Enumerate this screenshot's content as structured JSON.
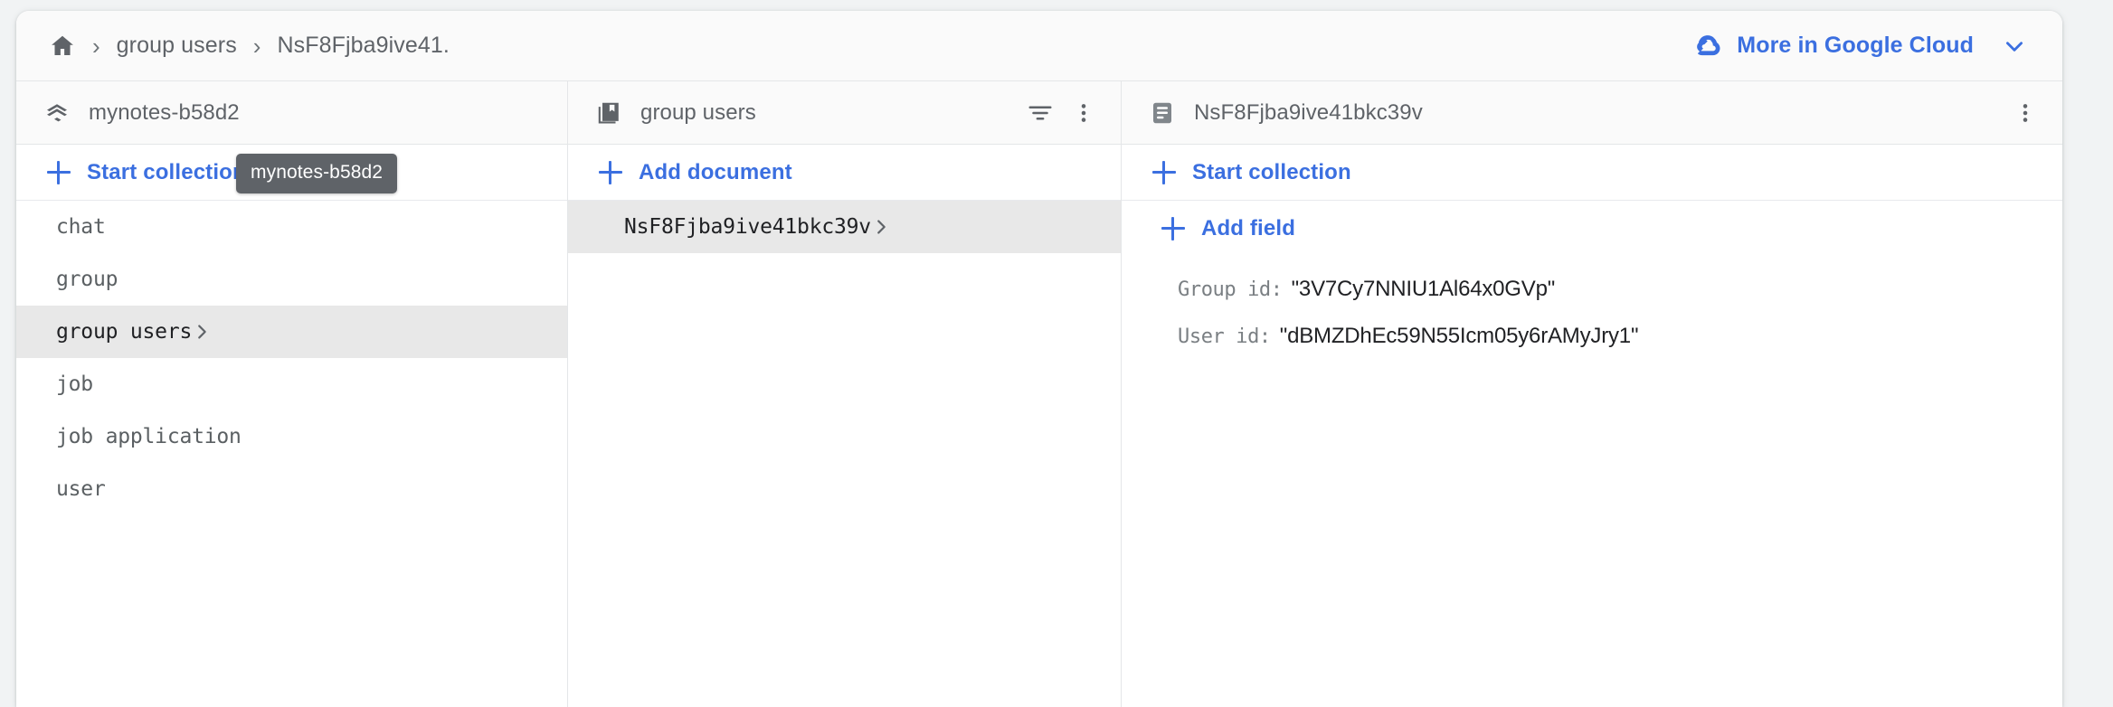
{
  "colors": {
    "accent": "#3b6fe0",
    "page_bg": "#f1f3f4",
    "panel_bg": "#ffffff",
    "header_bg": "#fafafa",
    "selected_row_bg": "#e8e8e8",
    "tooltip_bg": "#5f6368",
    "muted_text": "#5f6368"
  },
  "breadcrumb": {
    "home_icon": "home-icon",
    "separator": "chevron-right-icon",
    "items": [
      {
        "label": "group users"
      },
      {
        "label": "NsF8Fjba9ive41."
      }
    ]
  },
  "topbar": {
    "cloud_icon": "google-cloud-icon",
    "more_label": "More in Google Cloud",
    "chevron_icon": "chevron-down-icon"
  },
  "tooltip": {
    "text": "mynotes-b58d2"
  },
  "panel_database": {
    "icon": "firestore-database-icon",
    "title": "mynotes-b58d2",
    "start_collection_label": "Start collection",
    "start_collection_icon": "plus-icon",
    "collections": [
      {
        "name": "chat",
        "selected": false
      },
      {
        "name": "group",
        "selected": false
      },
      {
        "name": "group users",
        "selected": true
      },
      {
        "name": "job",
        "selected": false
      },
      {
        "name": "job application",
        "selected": false
      },
      {
        "name": "user",
        "selected": false
      }
    ]
  },
  "panel_collection": {
    "icon": "collection-icon",
    "title": "group users",
    "filter_icon": "filter-icon",
    "menu_icon": "more-vert-icon",
    "add_document_label": "Add document",
    "add_document_icon": "plus-icon",
    "documents": [
      {
        "id": "NsF8Fjba9ive41bkc39v",
        "selected": true
      }
    ]
  },
  "panel_document": {
    "icon": "document-icon",
    "title": "NsF8Fjba9ive41bkc39v",
    "menu_icon": "more-vert-icon",
    "start_collection_label": "Start collection",
    "start_collection_icon": "plus-icon",
    "add_field_label": "Add field",
    "add_field_icon": "plus-icon",
    "fields": [
      {
        "key": "Group id:",
        "value": "\"3V7Cy7NNIU1Al64x0GVp\""
      },
      {
        "key": "User id:",
        "value": "\"dBMZDhEc59N55Icm05y6rAMyJry1\""
      }
    ]
  }
}
